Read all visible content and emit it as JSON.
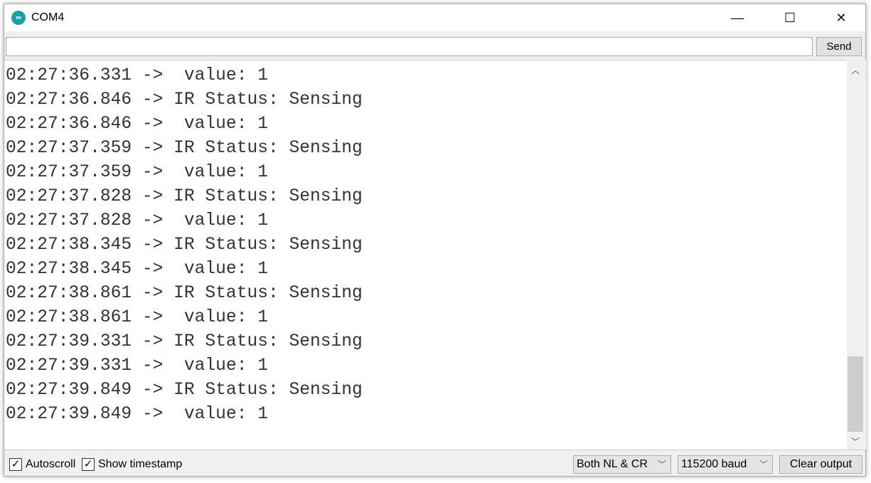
{
  "window": {
    "title": "COM4",
    "minimize": "—",
    "maximize": "☐",
    "close": "✕"
  },
  "toolbar": {
    "input_value": "",
    "send_label": "Send"
  },
  "output": {
    "lines": [
      "02:27:36.331 ->  value: 1",
      "02:27:36.846 -> IR Status: Sensing",
      "02:27:36.846 ->  value: 1",
      "02:27:37.359 -> IR Status: Sensing",
      "02:27:37.359 ->  value: 1",
      "02:27:37.828 -> IR Status: Sensing",
      "02:27:37.828 ->  value: 1",
      "02:27:38.345 -> IR Status: Sensing",
      "02:27:38.345 ->  value: 1",
      "02:27:38.861 -> IR Status: Sensing",
      "02:27:38.861 ->  value: 1",
      "02:27:39.331 -> IR Status: Sensing",
      "02:27:39.331 ->  value: 1",
      "02:27:39.849 -> IR Status: Sensing",
      "02:27:39.849 ->  value: 1"
    ]
  },
  "footer": {
    "autoscroll_label": "Autoscroll",
    "autoscroll_checked": true,
    "timestamp_label": "Show timestamp",
    "timestamp_checked": true,
    "line_ending": "Both NL & CR",
    "baud": "115200 baud",
    "clear_label": "Clear output"
  }
}
